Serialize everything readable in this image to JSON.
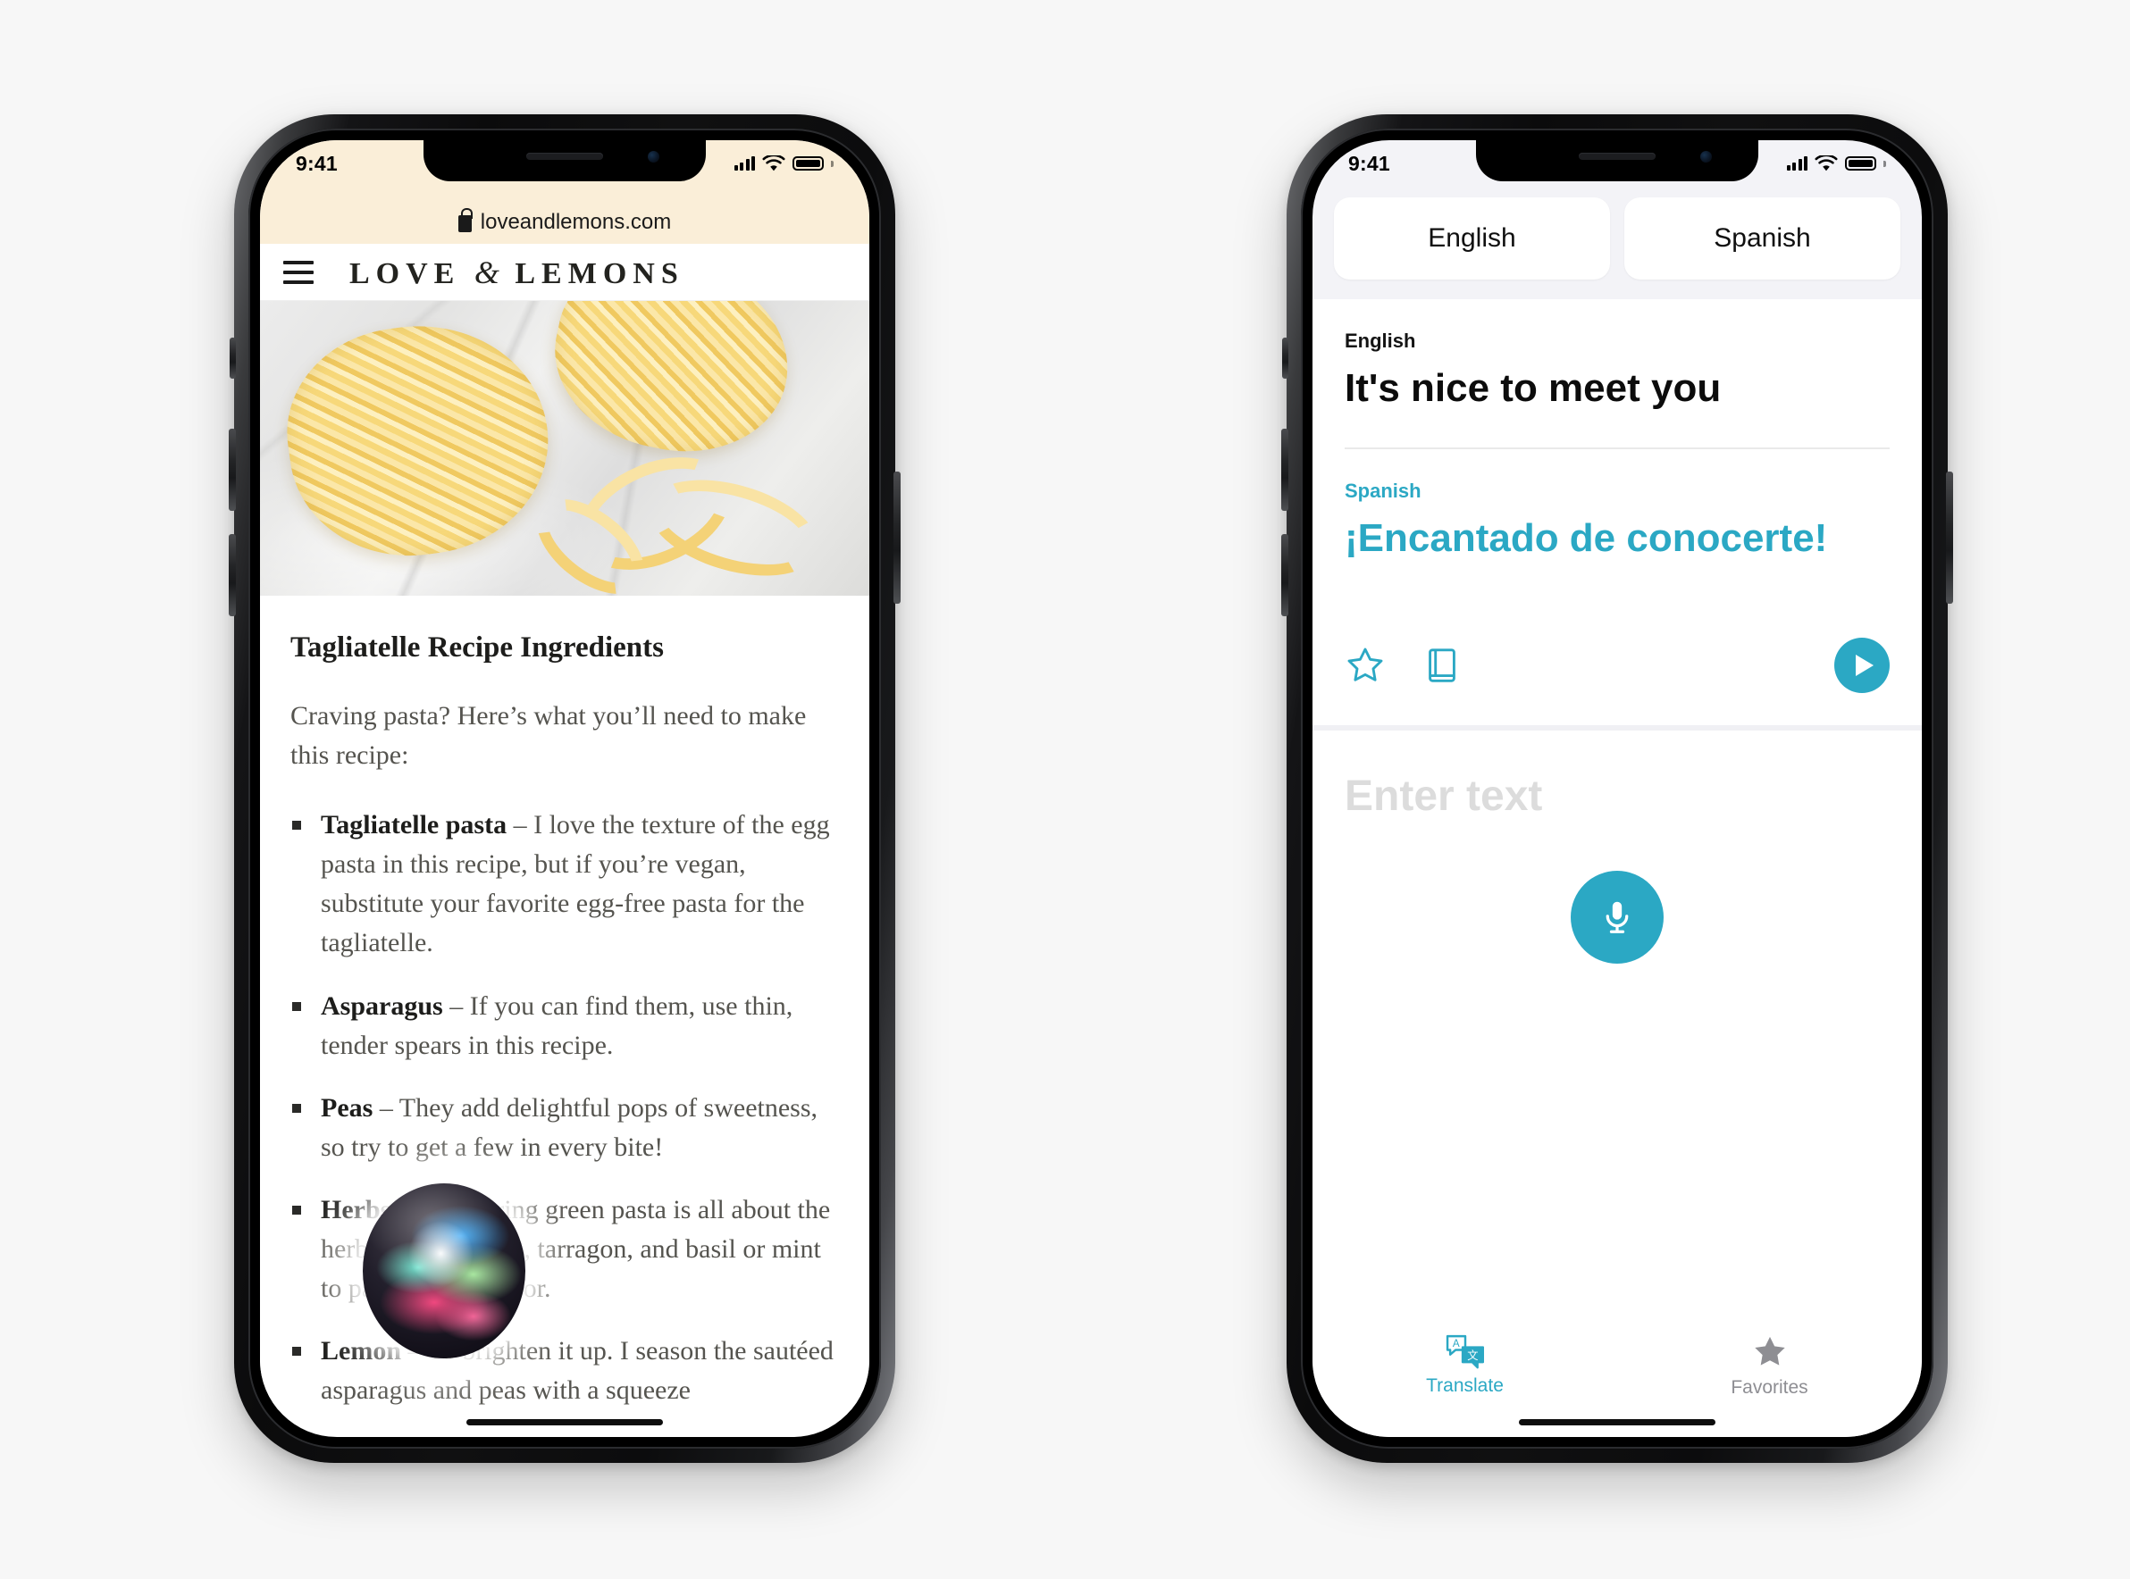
{
  "scene": {
    "background_color": "#f7f7f7",
    "device_count": 2
  },
  "left_phone": {
    "device_name": "iPhone",
    "status_bar": {
      "time": "9:41",
      "signal_icon": "cellular-bars-icon",
      "wifi_icon": "wifi-icon",
      "battery_icon": "battery-full-icon",
      "background_color": "#faeed8"
    },
    "browser": {
      "app": "Safari",
      "url": "loveandlemons.com",
      "lock_icon": "lock-icon",
      "toolbar_color": "#faeed8"
    },
    "site": {
      "menu_icon": "hamburger-menu-icon",
      "brand_part1": "LOVE",
      "brand_amp": "&",
      "brand_part2": "LEMONS",
      "hero_image_alt": "tagliatelle-pasta-nests-on-marble"
    },
    "article": {
      "title": "Tagliatelle Recipe Ingredients",
      "intro": "Craving pasta? Here’s what you’ll need to make this recipe:",
      "ingredients": [
        {
          "name": "Tagliatelle pasta",
          "description": " – I love the texture of the egg pasta in this recipe, but if you’re vegan, substitute your favorite egg-free pasta for the tagliatelle."
        },
        {
          "name": "Asparagus",
          "description": " – If you can find them, use thin, tender spears in this recipe."
        },
        {
          "name": "Peas",
          "description": " – They add delightful pops of sweetness, so try to get a few in every bite!"
        },
        {
          "name": "Herbs",
          "description": " – This spring green pasta is all about the herbs! I add chives, tarragon, and basil or mint to pack it with flavor."
        },
        {
          "name": "Lemon",
          "description": " – To brighten it up. I season the sautéed asparagus and peas with a squeeze"
        }
      ]
    },
    "siri": {
      "icon_name": "siri-orb",
      "state": "listening"
    }
  },
  "right_phone": {
    "device_name": "iPhone",
    "status_bar": {
      "time": "9:41",
      "signal_icon": "cellular-bars-icon",
      "wifi_icon": "wifi-icon",
      "battery_icon": "battery-full-icon",
      "background_color": "#f3f3f7"
    },
    "app": {
      "name": "Translate",
      "accent_color": "#2ba8c4",
      "language_selector": {
        "source_label": "English",
        "target_label": "Spanish"
      },
      "translation_card": {
        "source_language": "English",
        "source_text": "It's nice to meet you",
        "target_language": "Spanish",
        "target_text": "¡Encantado de conocerte!",
        "actions": {
          "favorite_icon": "star-outline-icon",
          "dictionary_icon": "book-icon",
          "play_icon": "play-button-icon"
        }
      },
      "input_area": {
        "placeholder": "Enter text",
        "mic_icon": "microphone-icon"
      },
      "tab_bar": {
        "tabs": [
          {
            "label": "Translate",
            "icon": "translate-bubbles-icon",
            "active": true
          },
          {
            "label": "Favorites",
            "icon": "star-filled-icon",
            "active": false
          }
        ]
      }
    }
  }
}
